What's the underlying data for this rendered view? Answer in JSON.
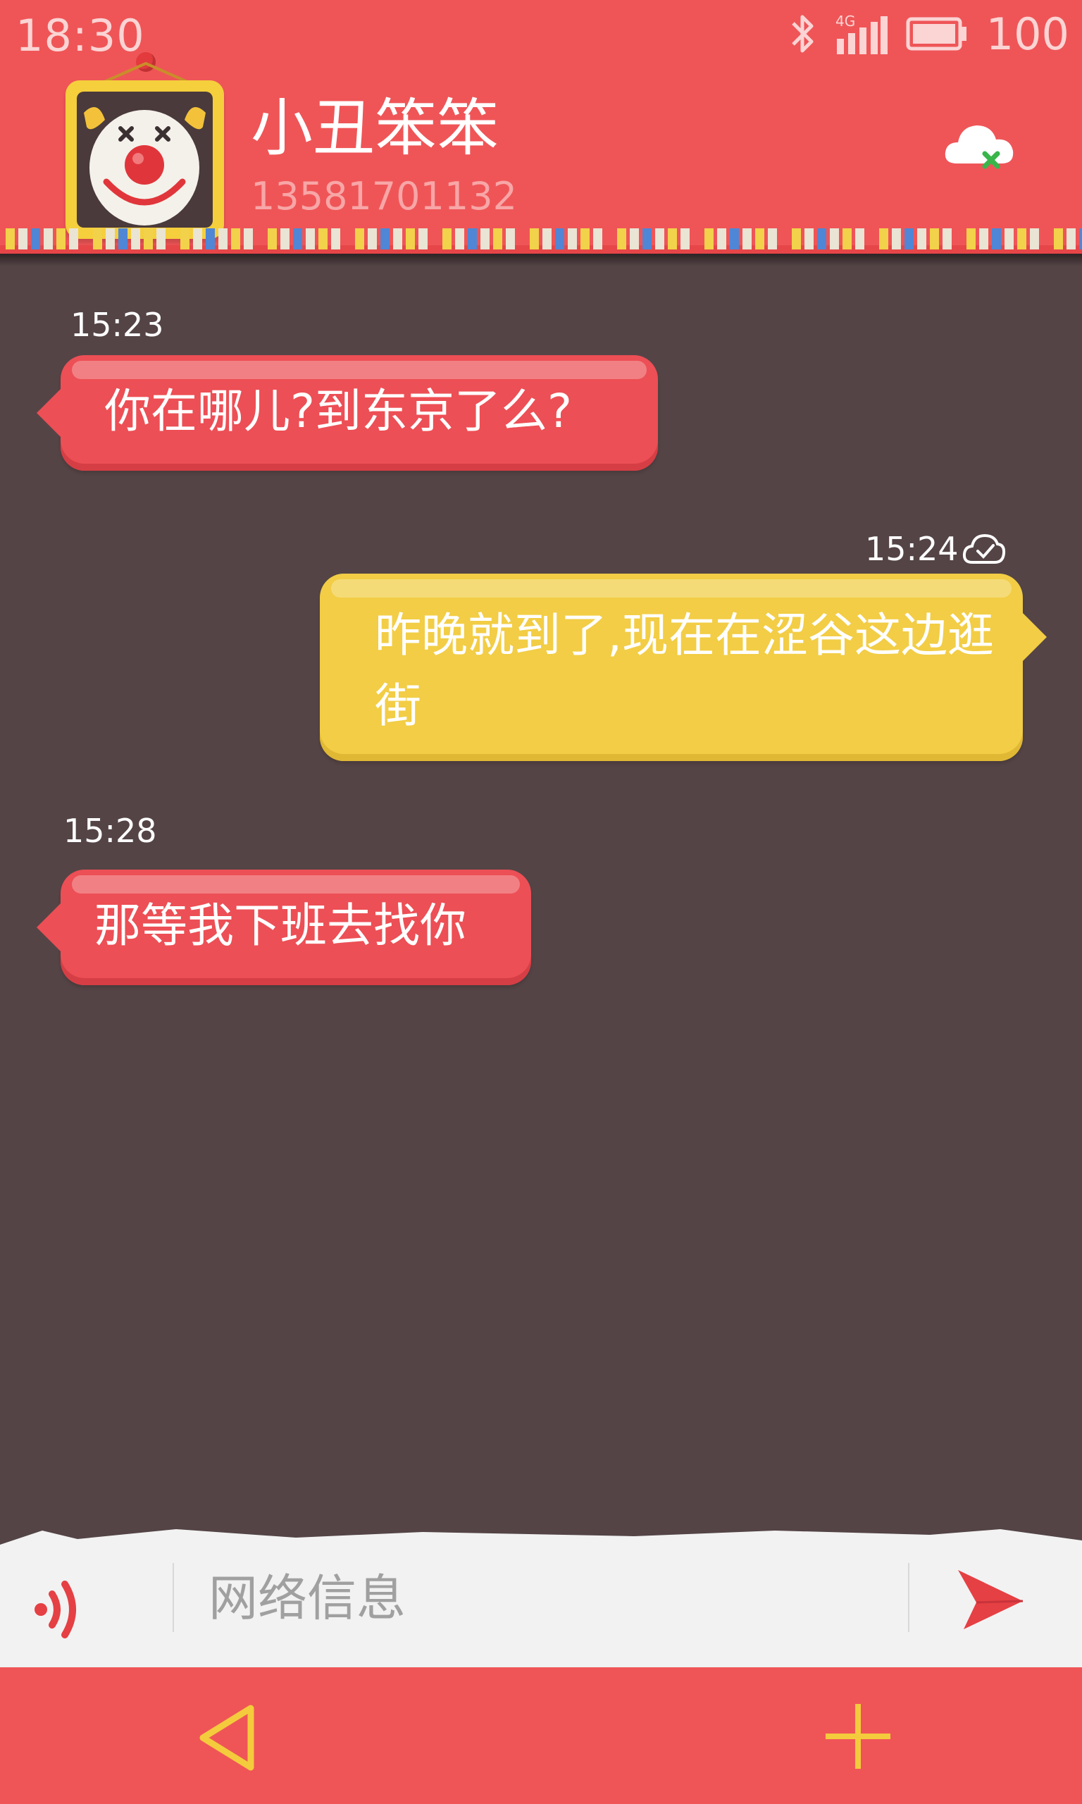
{
  "status_bar": {
    "time": "18:30",
    "battery": "100",
    "network": "4G",
    "icons": [
      "bluetooth-icon",
      "signal-4g-icon",
      "battery-icon"
    ]
  },
  "contact": {
    "name": "小丑笨笨",
    "number": "13581701132",
    "avatar": "clown-avatar",
    "cloud_icon": "cloud-sync-off-icon"
  },
  "messages": [
    {
      "direction": "received",
      "time": "15:23",
      "text": "你在哪儿?到东京了么?"
    },
    {
      "direction": "sent",
      "time": "15:24",
      "status_icon": "cloud-check-icon",
      "text": "昨晚就到了,现在在涩谷这边逛街"
    },
    {
      "direction": "received",
      "time": "15:28",
      "text": "那等我下班去找你"
    }
  ],
  "composer": {
    "placeholder": "网络信息",
    "voice_icon": "voice-icon",
    "send_icon": "send-icon"
  },
  "nav": {
    "back_icon": "back-triangle-icon",
    "add_icon": "plus-icon"
  },
  "colors": {
    "header": "#ef5557",
    "background": "#544446",
    "received_bubble": "#ec4f55",
    "sent_bubble": "#f2cd45",
    "nav_icon": "#f4cb3c",
    "input_bar": "#f2f2f2"
  }
}
